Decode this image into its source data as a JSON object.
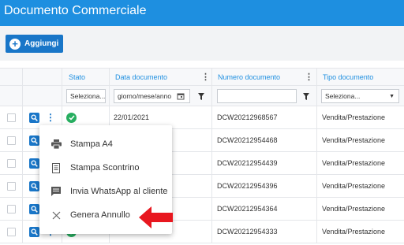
{
  "app": {
    "title": "Documento Commerciale"
  },
  "toolbar": {
    "add_label": "Aggiungi"
  },
  "columns": {
    "stato": "Stato",
    "data": "Data documento",
    "numero": "Numero documento",
    "tipo": "Tipo documento"
  },
  "filters": {
    "stato_placeholder": "Seleziona...",
    "data_placeholder": "giorno/mese/anno",
    "numero_value": "",
    "tipo_placeholder": "Seleziona..."
  },
  "rows": [
    {
      "date": "22/01/2021",
      "number": "DCW20212968567",
      "type": "Vendita/Prestazione"
    },
    {
      "date": "",
      "number": "DCW20212954468",
      "type": "Vendita/Prestazione"
    },
    {
      "date": "",
      "number": "DCW20212954439",
      "type": "Vendita/Prestazione"
    },
    {
      "date": "",
      "number": "DCW20212954396",
      "type": "Vendita/Prestazione"
    },
    {
      "date": "",
      "number": "DCW20212954364",
      "type": "Vendita/Prestazione"
    },
    {
      "date": "20/01/2021",
      "number": "DCW20212954333",
      "type": "Vendita/Prestazione"
    }
  ],
  "context_menu": {
    "items": [
      {
        "label": "Stampa A4",
        "icon": "printer-icon"
      },
      {
        "label": "Stampa Scontrino",
        "icon": "receipt-icon"
      },
      {
        "label": "Invia WhatsApp al cliente",
        "icon": "message-icon"
      },
      {
        "label": "Genera Annullo",
        "icon": "close-icon"
      }
    ]
  },
  "colors": {
    "accent": "#1e8fe0",
    "button": "#1976c8",
    "success": "#27ae60",
    "arrow": "#e8171f"
  }
}
